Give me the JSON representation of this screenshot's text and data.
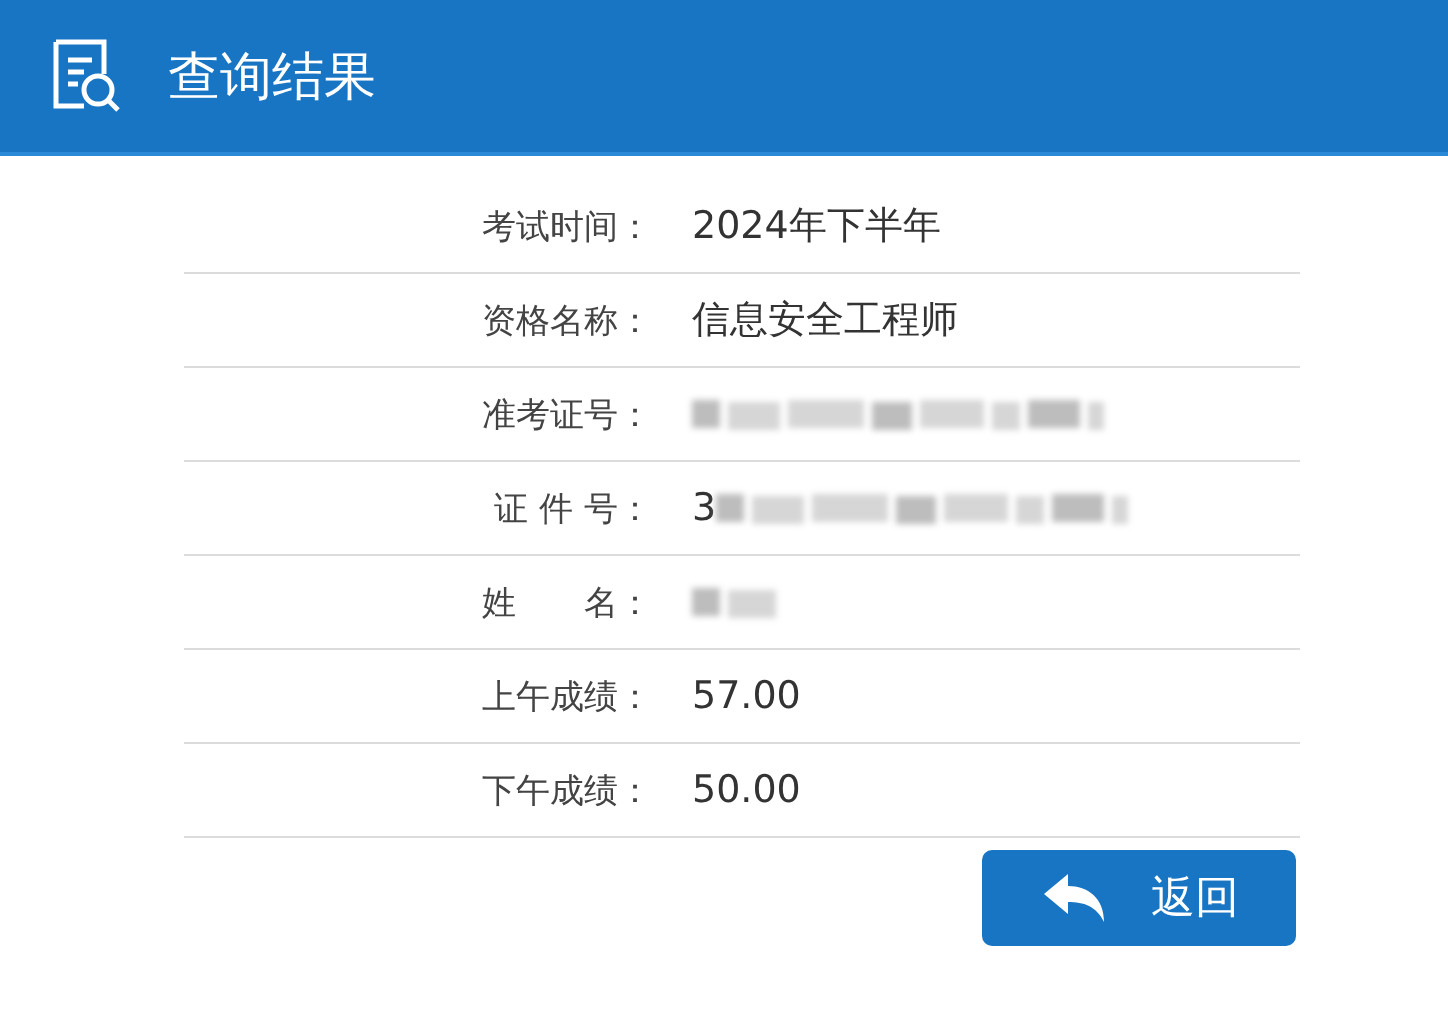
{
  "header": {
    "title": "查询结果"
  },
  "rows": [
    {
      "label": "考试时间：",
      "value": "2024年下半年"
    },
    {
      "label": "资格名称：",
      "value": "信息安全工程师"
    },
    {
      "label": "准考证号：",
      "redacted": true
    },
    {
      "label": "证 件 号：",
      "value": "3",
      "redacted": true
    },
    {
      "label": "姓　　名：",
      "redacted": true
    },
    {
      "label": "上午成绩：",
      "value": "57.00"
    },
    {
      "label": "下午成绩：",
      "value": "50.00"
    }
  ],
  "button": {
    "label": "返回"
  }
}
